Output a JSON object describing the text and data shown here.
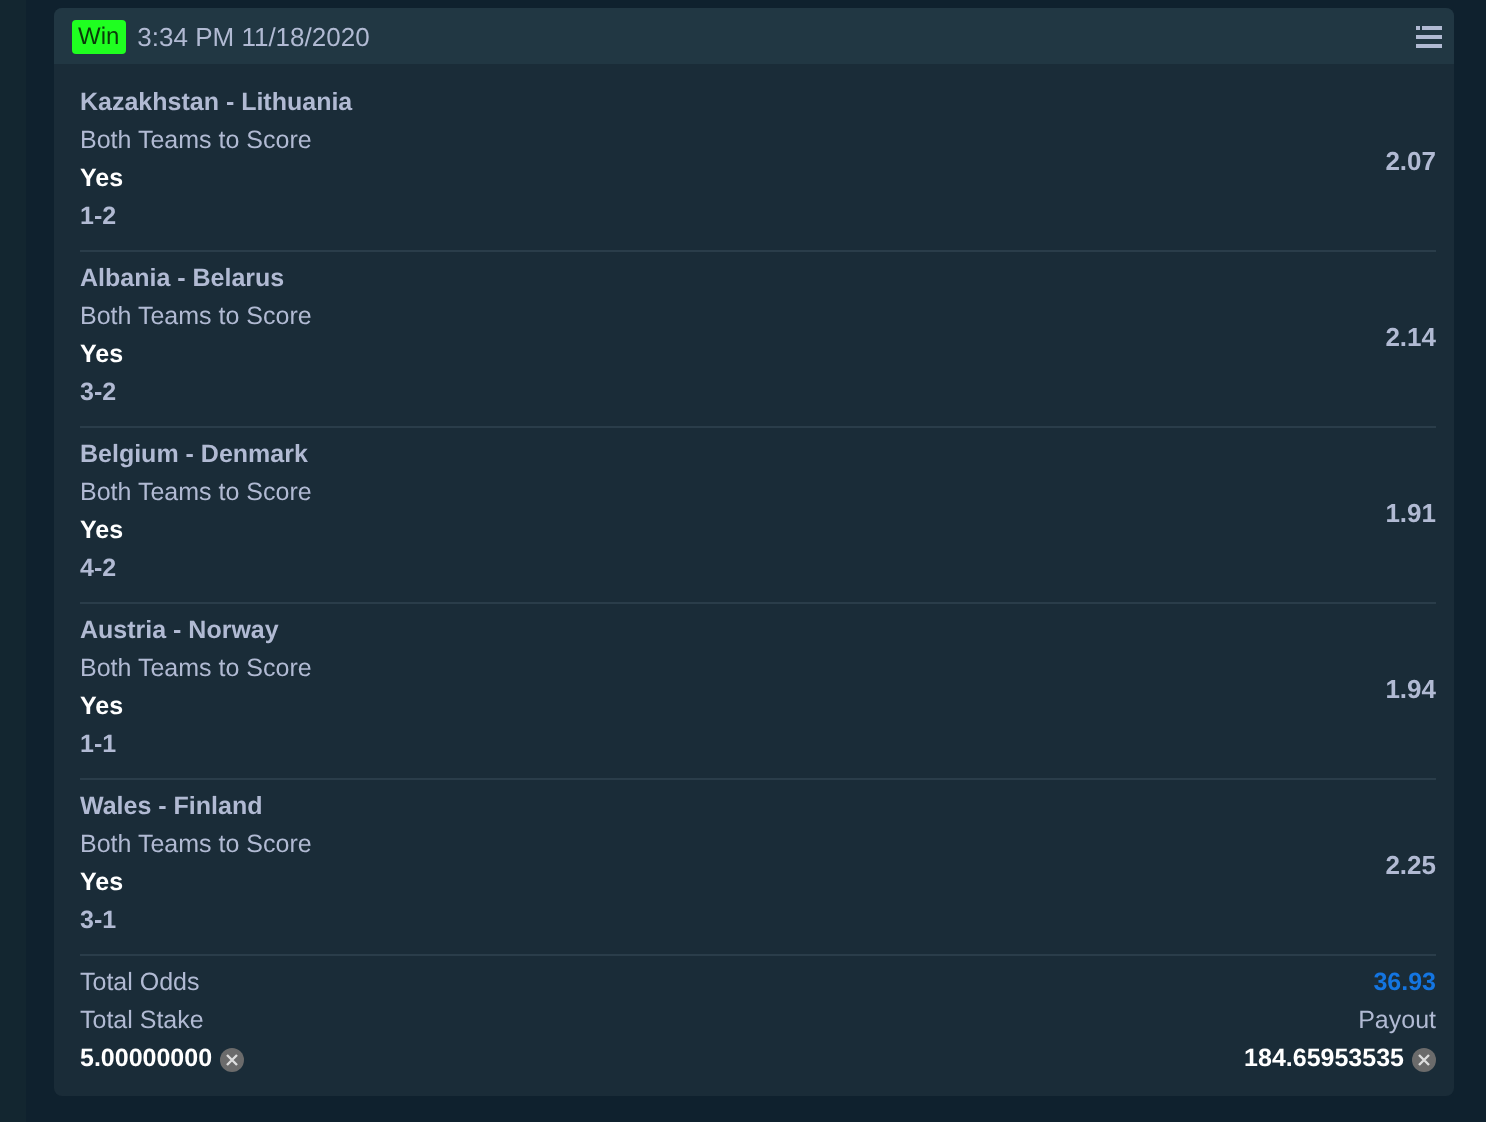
{
  "bet": {
    "status": {
      "label": "Win",
      "kind": "win"
    },
    "datetime": "3:34 PM 11/18/2020"
  },
  "legs": [
    {
      "match": "Kazakhstan - Lithuania",
      "market": "Both Teams to Score",
      "pick": "Yes",
      "score": "1-2",
      "odds": "2.07"
    },
    {
      "match": "Albania - Belarus",
      "market": "Both Teams to Score",
      "pick": "Yes",
      "score": "3-2",
      "odds": "2.14"
    },
    {
      "match": "Belgium - Denmark",
      "market": "Both Teams to Score",
      "pick": "Yes",
      "score": "4-2",
      "odds": "1.91"
    },
    {
      "match": "Austria - Norway",
      "market": "Both Teams to Score",
      "pick": "Yes",
      "score": "1-1",
      "odds": "1.94"
    },
    {
      "match": "Wales - Finland",
      "market": "Both Teams to Score",
      "pick": "Yes",
      "score": "3-1",
      "odds": "2.25"
    }
  ],
  "summary": {
    "total_odds_label": "Total Odds",
    "total_odds": "36.93",
    "stake_label": "Total Stake",
    "payout_label": "Payout",
    "stake": "5.00000000",
    "payout": "184.65953535"
  }
}
